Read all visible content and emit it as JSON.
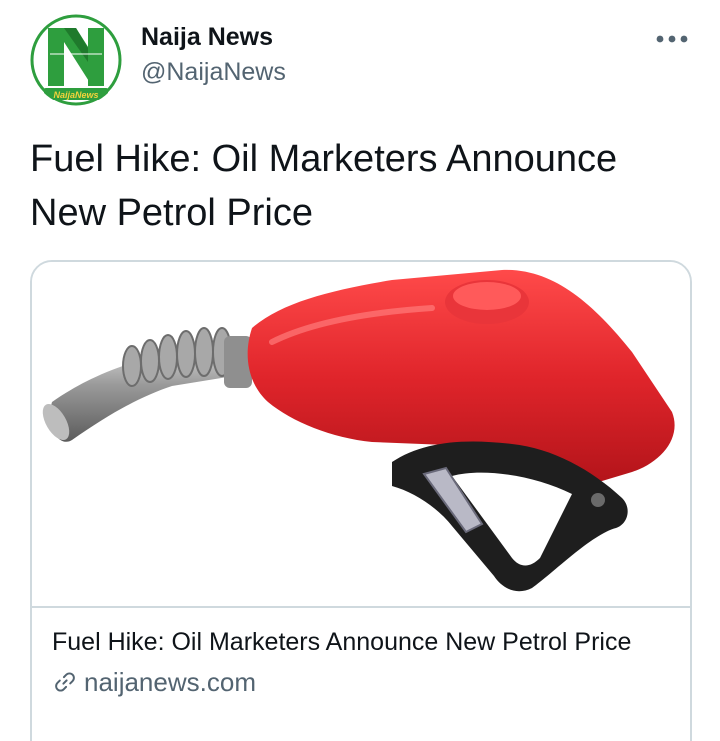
{
  "tweet": {
    "author": {
      "display_name": "Naija News",
      "handle": "@NaijaNews",
      "avatar_text": "NaijaNews"
    },
    "more_icon": "ellipsis-horizontal-icon",
    "text": "Fuel Hike: Oil Marketers Announce New Petrol Price"
  },
  "card": {
    "image_subject": "red-fuel-pump-nozzle",
    "title": "Fuel Hike: Oil Marketers Announce New Petrol Price",
    "domain": "naijanews.com",
    "link_icon": "link-icon"
  },
  "colors": {
    "brand_green": "#2e9e3e",
    "nozzle_red": "#e0252b",
    "text_primary": "#0f1419",
    "text_secondary": "#536471",
    "border": "#cfd9de"
  }
}
